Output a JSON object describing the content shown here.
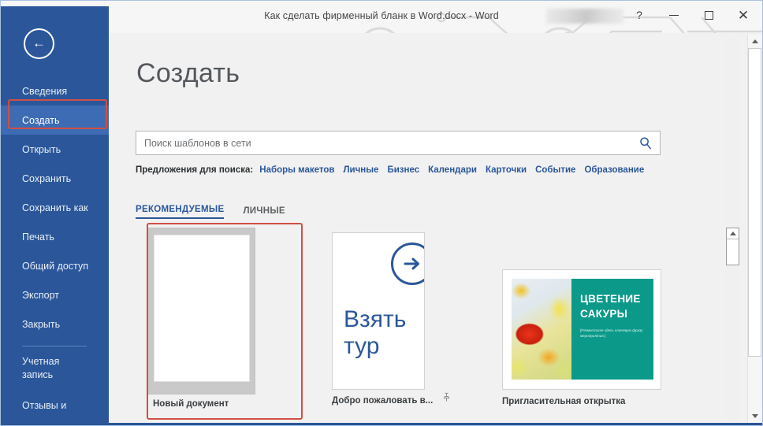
{
  "window": {
    "title": "Как сделать фирменный бланк в Word.docx  -  Word",
    "redacted_user_label": "",
    "help_label": "?",
    "minimize_label": "minimize",
    "maximize_label": "maximize",
    "close_label": "✕",
    "accent_color": "#2b579a",
    "annotation_color": "#cf5045"
  },
  "sidebar": {
    "back_icon": "←",
    "items": [
      {
        "label": "Сведения",
        "selected": false
      },
      {
        "label": "Создать",
        "selected": true
      },
      {
        "label": "Открыть",
        "selected": false
      },
      {
        "label": "Сохранить",
        "selected": false
      },
      {
        "label": "Сохранить как",
        "selected": false
      },
      {
        "label": "Печать",
        "selected": false
      },
      {
        "label": "Общий доступ",
        "selected": false
      },
      {
        "label": "Экспорт",
        "selected": false
      },
      {
        "label": "Закрыть",
        "selected": false
      }
    ],
    "footer_items": [
      {
        "label": "Учетная запись"
      },
      {
        "label": "Отзывы и"
      }
    ]
  },
  "main": {
    "page_title": "Создать",
    "search": {
      "placeholder": "Поиск шаблонов в сети",
      "value": "",
      "icon": "search-icon"
    },
    "suggestions": {
      "label": "Предложения для поиска:",
      "links": [
        "Наборы макетов",
        "Личные",
        "Бизнес",
        "Календари",
        "Карточки",
        "Событие",
        "Образование"
      ]
    },
    "tabs": [
      {
        "label": "РЕКОМЕНДУЕМЫЕ",
        "active": true
      },
      {
        "label": "ЛИЧНЫЕ",
        "active": false
      }
    ],
    "templates": [
      {
        "label": "Новый документ",
        "kind": "blank-document",
        "highlighted": true
      },
      {
        "label": "Добро пожаловать в...",
        "kind": "take-a-tour",
        "thumb_text_line1": "Взять",
        "thumb_text_line2": "тур",
        "arrow_icon": "→",
        "pinned": true,
        "pin_icon": "pin-icon"
      },
      {
        "label": "Пригласительная открытка",
        "kind": "invitation-card",
        "thumb_title_line1": "ЦВЕТЕНИЕ",
        "thumb_title_line2": "САКУРЫ",
        "thumb_subtitle": "[Разместите здесь ключевую фразу мероприятия.]",
        "panel_color": "#0b9a8a"
      }
    ]
  },
  "scrollbars": {
    "gallery": {
      "up_arrow": "▲"
    },
    "window": {
      "up_arrow": "▲",
      "down_arrow": "▼"
    }
  }
}
